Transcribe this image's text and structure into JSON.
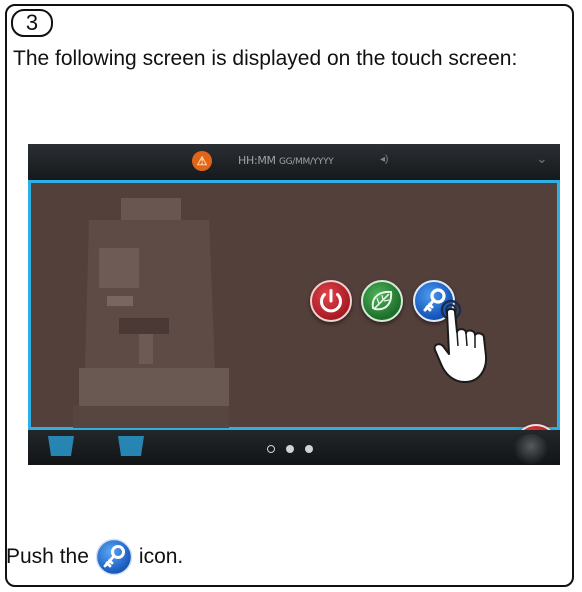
{
  "step": {
    "number": "3"
  },
  "text": {
    "intro": "The following screen is displayed on the touch screen:",
    "instruction_prefix": "Push the",
    "instruction_suffix": "icon."
  },
  "touch_screen": {
    "status_bar": {
      "time": "HH:MM",
      "date": "GG/MM/YYYY",
      "warning_icon": "warning-icon",
      "volume_icon": "volume-icon",
      "menu_icon": "chevron-down-icon"
    },
    "buttons": [
      {
        "name": "power",
        "icon": "power-icon",
        "color": "#c0202a"
      },
      {
        "name": "eco",
        "icon": "leaf-icon",
        "color": "#2a8a38"
      },
      {
        "name": "key",
        "icon": "key-icon",
        "color": "#1a63c8"
      }
    ],
    "close_icon": "close-icon",
    "page_indicator": {
      "pages": 3,
      "current": 1
    },
    "accent_color": "#2eb0e4",
    "panel_color": "#54403b"
  }
}
